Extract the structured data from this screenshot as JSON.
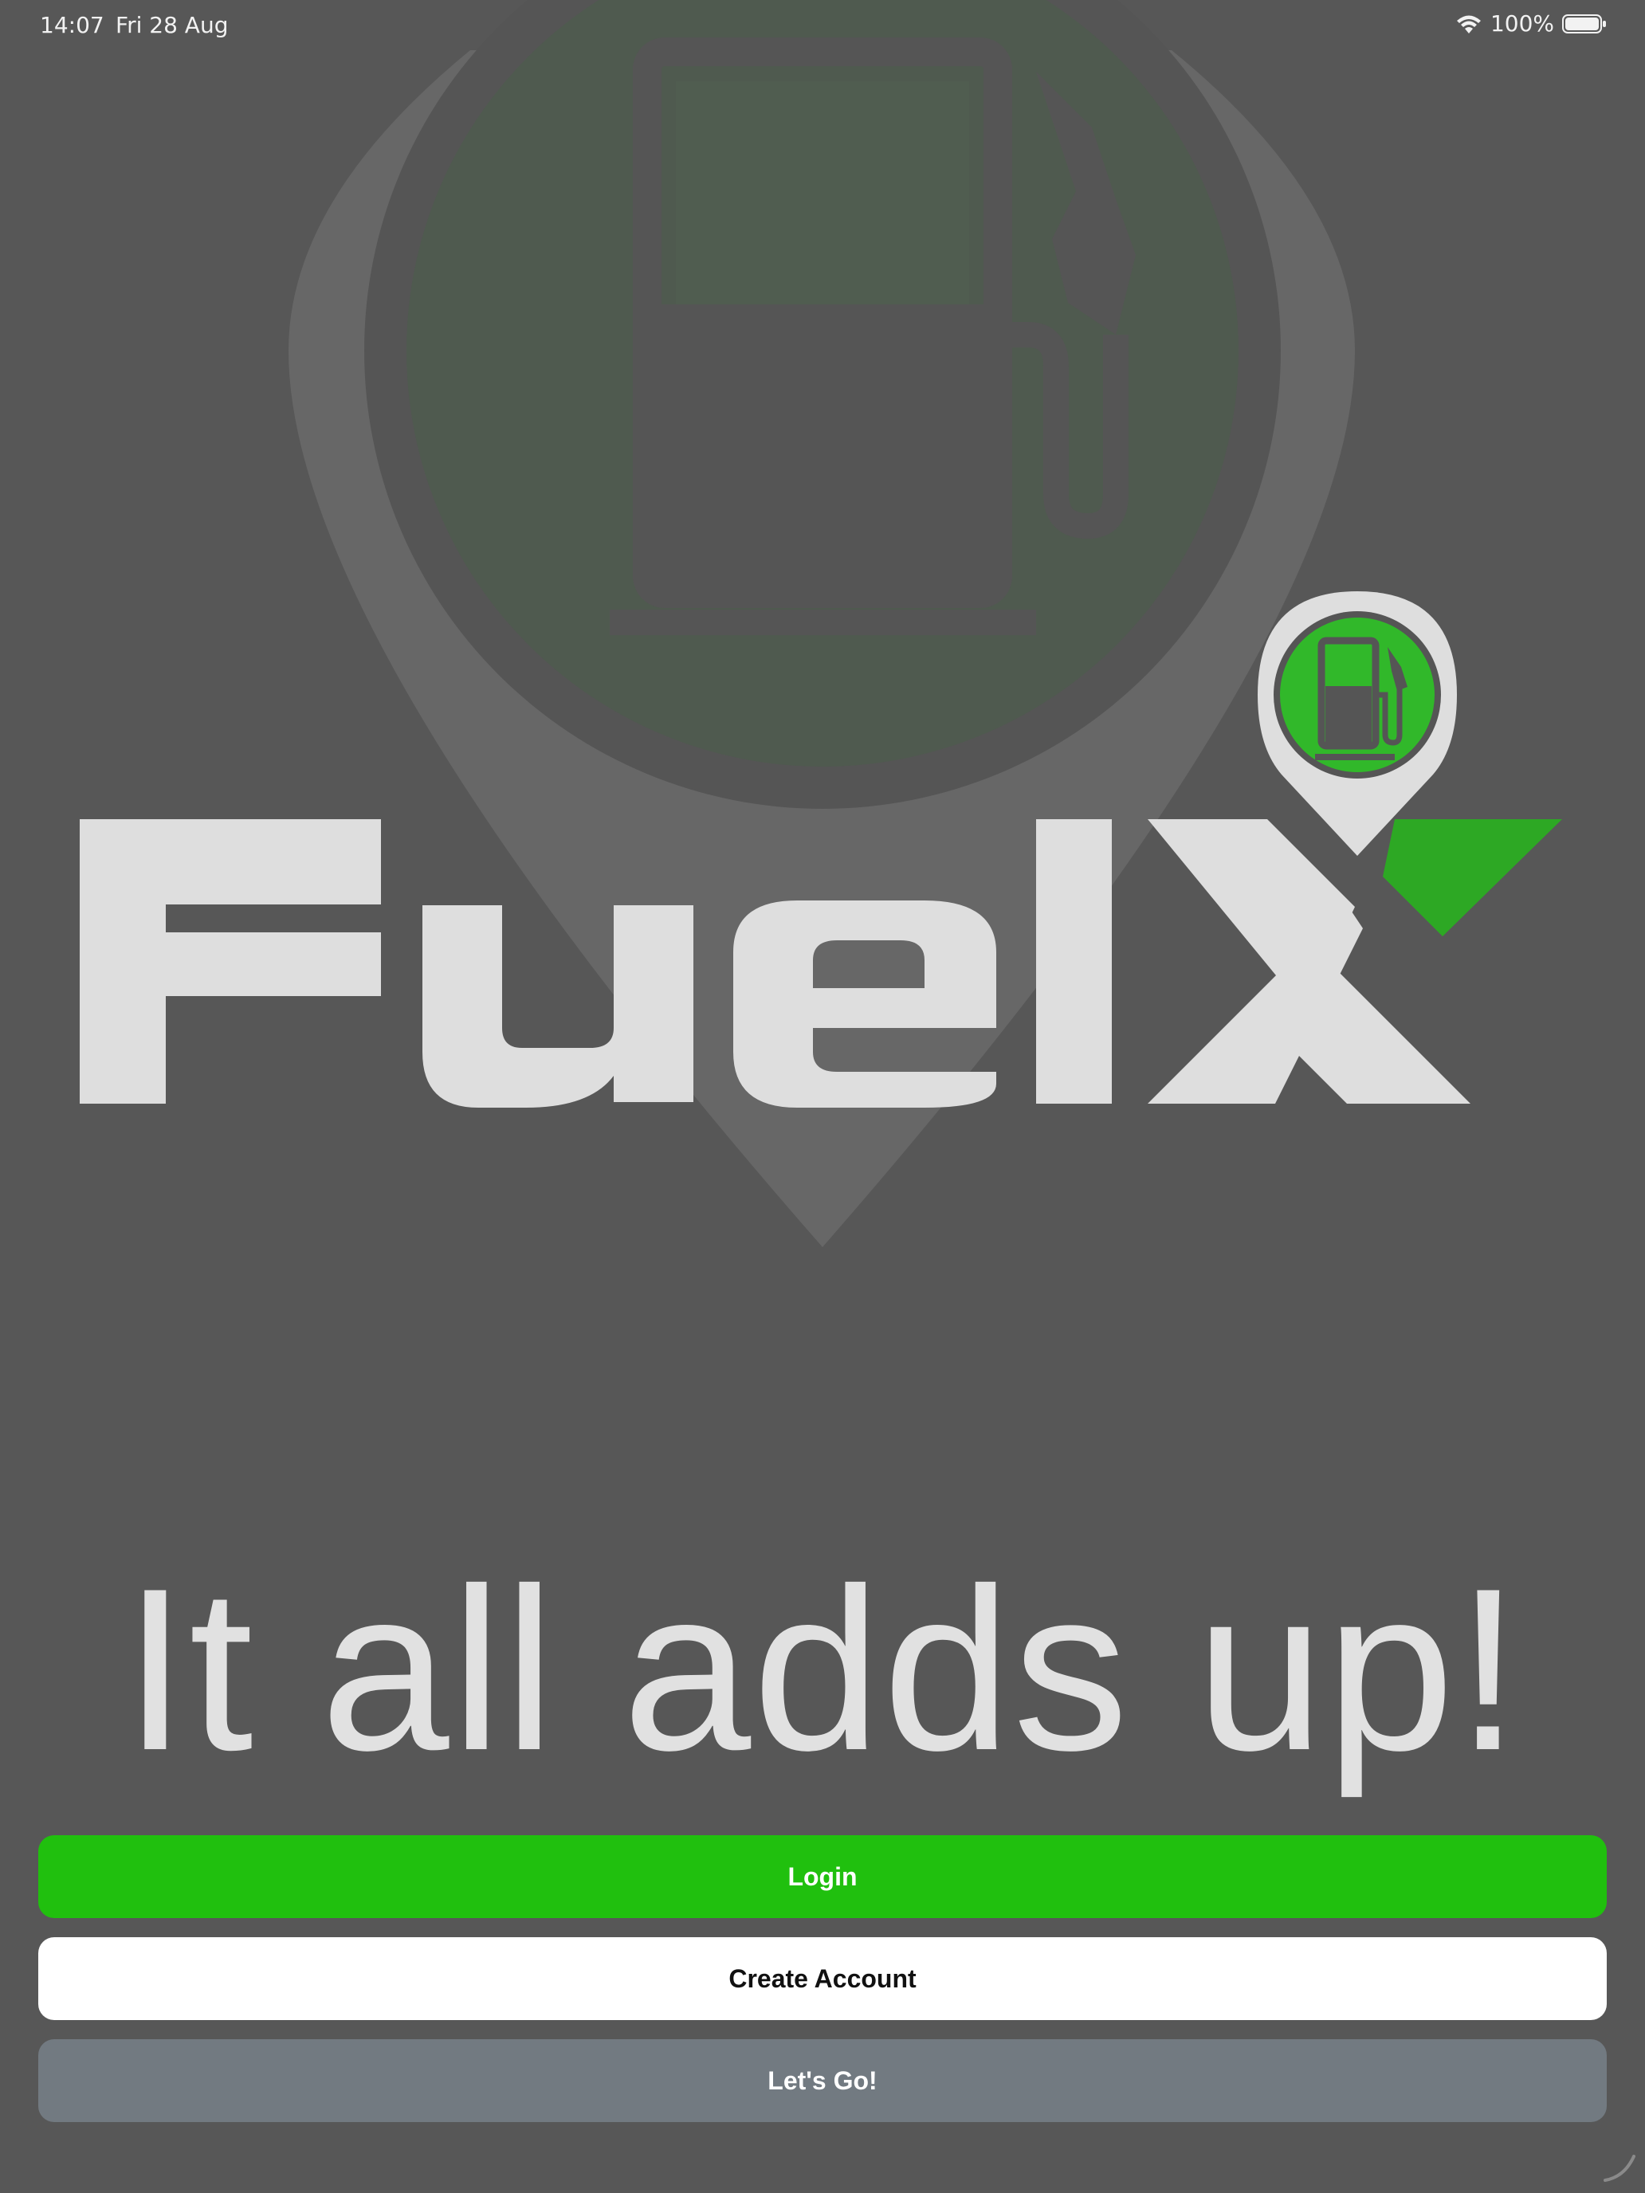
{
  "status_bar": {
    "time": "14:07",
    "date": "Fri 28 Aug",
    "battery_label": "100%",
    "icons": [
      "wifi-icon",
      "battery-icon"
    ]
  },
  "logo": {
    "wordmark": "FuelX",
    "background_icon": "fuel-pump-pin-icon",
    "badge_icon": "fuel-pump-pin-icon"
  },
  "tagline": "It all adds up!",
  "buttons": {
    "login": "Login",
    "create_account": "Create Account",
    "lets_go": "Let's Go!"
  },
  "colors": {
    "background": "#575757",
    "brand_green": "#20c00e",
    "logo_gray": "#dedede",
    "secondary_button": "#727a81"
  }
}
